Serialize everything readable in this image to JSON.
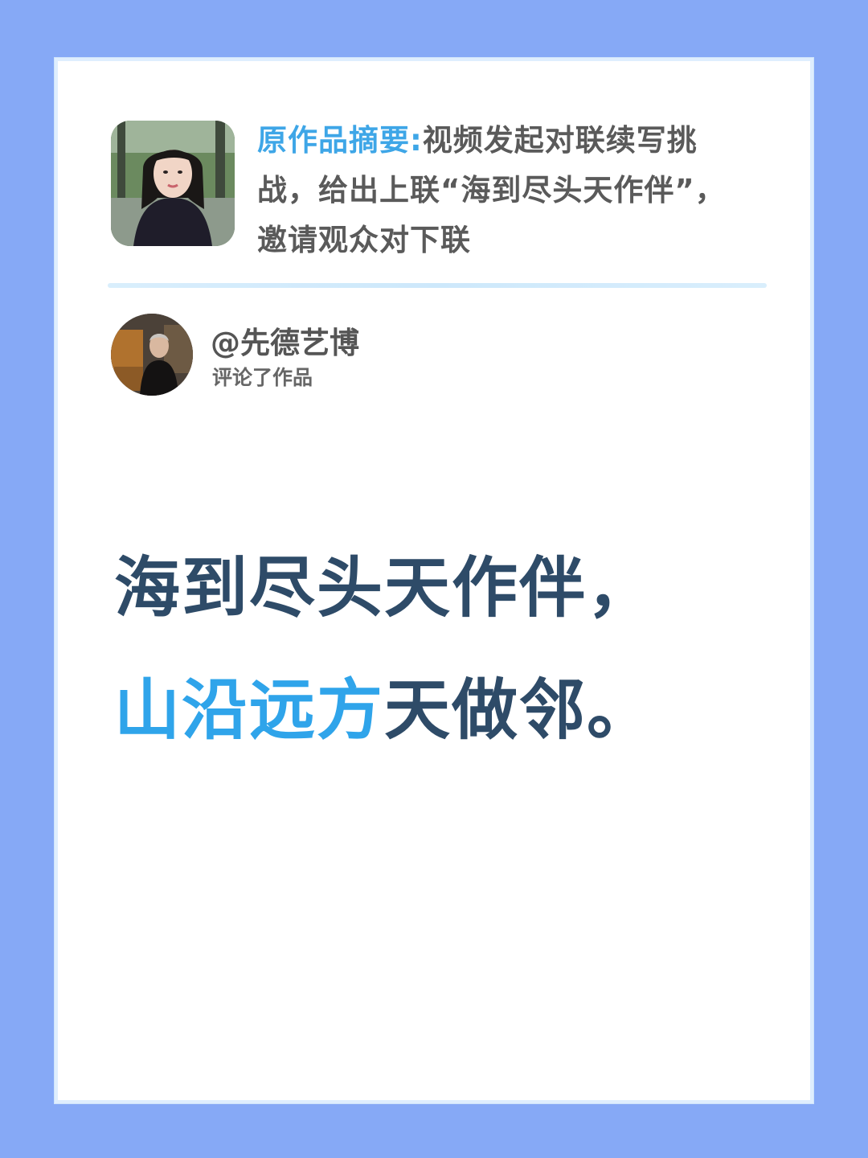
{
  "summary": {
    "label": "原作品摘要:",
    "text": "视频发起对联续写挑战，给出上联“海到尽头天作伴”，邀请观众对下联"
  },
  "author": {
    "name": "@先德艺博",
    "action": "评论了作品"
  },
  "couplet": {
    "line1": "海到尽头天作伴，",
    "line2_highlight": "山沿远方",
    "line2_rest": "天做邻。"
  },
  "colors": {
    "background": "#86a9f6",
    "accent": "#2fa4ea",
    "couplet_text": "#2e4b68"
  }
}
